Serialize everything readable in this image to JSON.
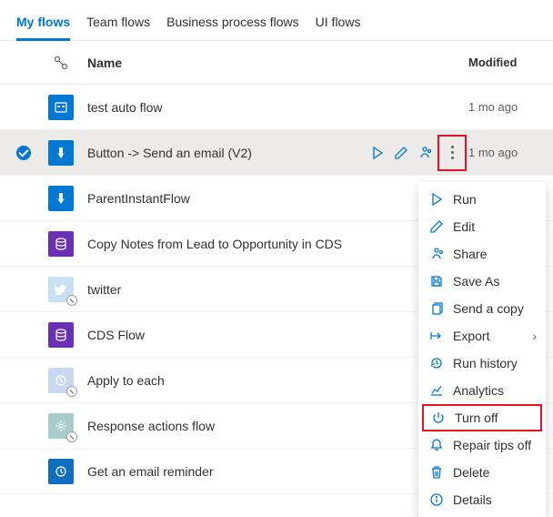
{
  "tabs": {
    "my_flows": "My flows",
    "team_flows": "Team flows",
    "bpf": "Business process flows",
    "ui_flows": "UI flows"
  },
  "headers": {
    "name": "Name",
    "modified": "Modified"
  },
  "flows": [
    {
      "name": "test auto flow",
      "modified": "1 mo ago"
    },
    {
      "name": "Button -> Send an email (V2)",
      "modified": "1 mo ago"
    },
    {
      "name": "ParentInstantFlow",
      "modified": ""
    },
    {
      "name": "Copy Notes from Lead to Opportunity in CDS",
      "modified": ""
    },
    {
      "name": "twitter",
      "modified": ""
    },
    {
      "name": "CDS Flow",
      "modified": ""
    },
    {
      "name": "Apply to each",
      "modified": ""
    },
    {
      "name": "Response actions flow",
      "modified": ""
    },
    {
      "name": "Get an email reminder",
      "modified": ""
    }
  ],
  "menu": {
    "run": "Run",
    "edit": "Edit",
    "share": "Share",
    "save_as": "Save As",
    "send_copy": "Send a copy",
    "export": "Export",
    "run_history": "Run history",
    "analytics": "Analytics",
    "turn_off": "Turn off",
    "repair_tips_off": "Repair tips off",
    "delete": "Delete",
    "details": "Details"
  }
}
